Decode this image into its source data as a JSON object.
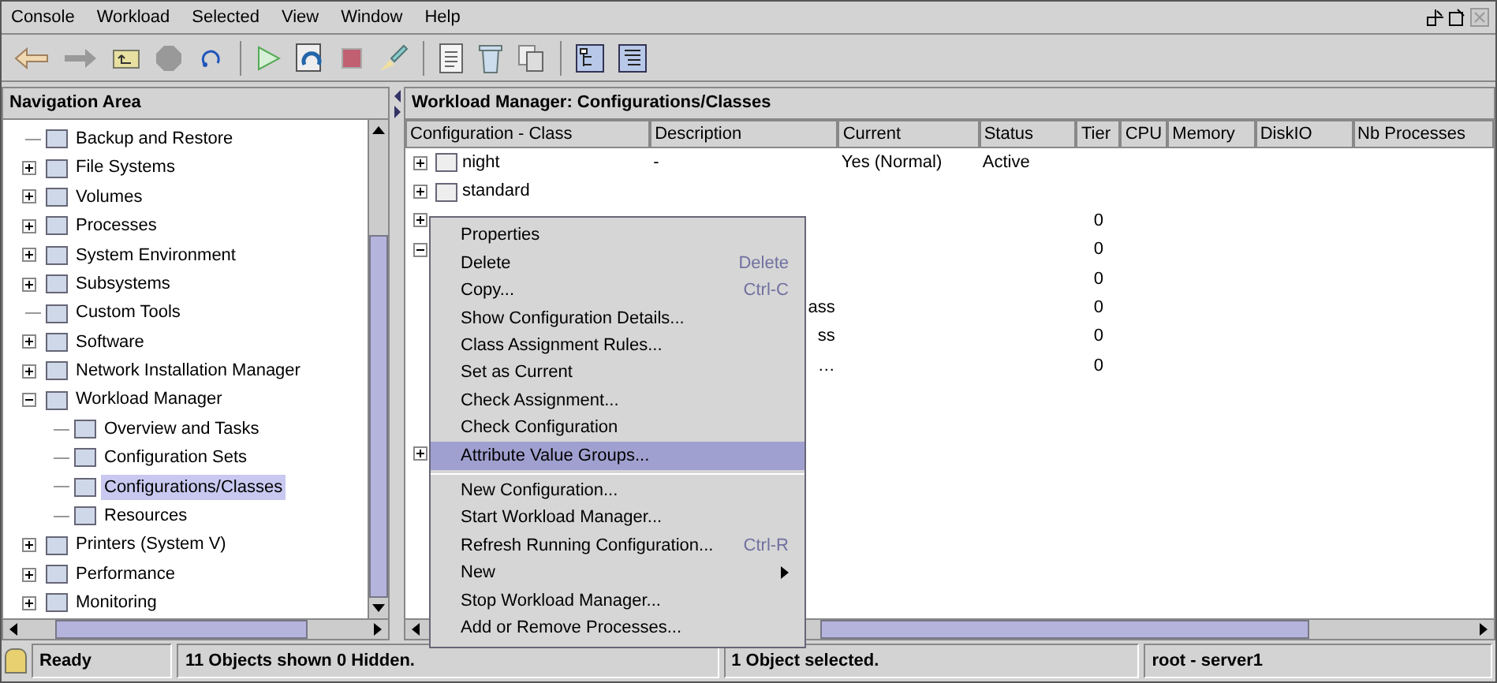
{
  "menu_bar": [
    "Console",
    "Workload",
    "Selected",
    "View",
    "Window",
    "Help"
  ],
  "navigation": {
    "title": "Navigation Area",
    "tree": [
      {
        "label": "Backup and Restore"
      },
      {
        "label": "File Systems",
        "expanded": false
      },
      {
        "label": "Volumes",
        "expanded": false
      },
      {
        "label": "Processes",
        "expanded": false
      },
      {
        "label": "System Environment",
        "expanded": false
      },
      {
        "label": "Subsystems",
        "expanded": false
      },
      {
        "label": "Custom Tools"
      },
      {
        "label": "Software",
        "expanded": false
      },
      {
        "label": "Network Installation Manager",
        "expanded": false
      },
      {
        "label": "Workload Manager",
        "expanded": true,
        "children": [
          {
            "label": "Overview and Tasks",
            "selected": false
          },
          {
            "label": "Configuration Sets",
            "selected": false
          },
          {
            "label": "Configurations/Classes",
            "selected": true
          },
          {
            "label": "Resources",
            "selected": false
          }
        ]
      },
      {
        "label": "Printers (System V)",
        "expanded": false
      },
      {
        "label": "Performance",
        "expanded": false
      },
      {
        "label": "Monitoring",
        "expanded": false
      }
    ]
  },
  "content": {
    "title": "Workload Manager: Configurations/Classes",
    "columns": [
      "Configuration - Class",
      "Description",
      "Current",
      "Status",
      "Tier",
      "CPU",
      "Memory",
      "DiskIO",
      "Nb Processes"
    ],
    "rows": [
      {
        "expanded": false,
        "cells": [
          "night",
          "-",
          "Yes (Normal)",
          "Active",
          "",
          "",
          "",
          "",
          ""
        ]
      },
      {
        "expanded": false,
        "cells": [
          "standard",
          "",
          "",
          "",
          "",
          "",
          "",
          "",
          ""
        ]
      },
      {
        "expanded": false,
        "cells": [
          "",
          "",
          "",
          "",
          "0",
          "",
          "",
          "",
          ""
        ]
      },
      {
        "expanded": true,
        "cells": [
          "",
          "",
          "",
          "",
          "0",
          "",
          "",
          "",
          ""
        ]
      },
      {
        "cells": [
          "",
          "",
          "",
          "",
          "0",
          "",
          "",
          "",
          ""
        ]
      },
      {
        "cells": [
          "",
          "ass",
          "",
          "",
          "0",
          "",
          "",
          "",
          ""
        ]
      },
      {
        "cells": [
          "",
          "ss",
          "",
          "",
          "0",
          "",
          "",
          "",
          ""
        ]
      },
      {
        "cells": [
          "",
          "…",
          "",
          "",
          "0",
          "",
          "",
          "",
          ""
        ]
      },
      {
        "cells": [
          "",
          "",
          "",
          "",
          "",
          "",
          "",
          "",
          ""
        ]
      },
      {
        "cells": [
          "",
          "",
          "",
          "",
          "",
          "",
          "",
          "",
          ""
        ]
      },
      {
        "expanded": false,
        "cells": [
          "",
          "",
          "",
          "",
          "",
          "",
          "",
          "",
          ""
        ]
      }
    ]
  },
  "context_menu": [
    {
      "kind": "item",
      "label": "Properties",
      "selected": false
    },
    {
      "kind": "item",
      "label": "Delete",
      "shortcut": "Delete",
      "selected": false
    },
    {
      "kind": "item",
      "label": "Copy...",
      "shortcut": "Ctrl-C",
      "selected": false
    },
    {
      "kind": "item",
      "label": "Show Configuration Details...",
      "selected": false
    },
    {
      "kind": "item",
      "label": "Class Assignment Rules...",
      "selected": false
    },
    {
      "kind": "item",
      "label": "Set as Current",
      "selected": false
    },
    {
      "kind": "item",
      "label": "Check Assignment...",
      "selected": false
    },
    {
      "kind": "item",
      "label": "Check Configuration",
      "selected": false
    },
    {
      "kind": "item",
      "label": "Attribute Value Groups...",
      "selected": true
    },
    {
      "kind": "separator"
    },
    {
      "kind": "item",
      "label": "New Configuration...",
      "selected": false
    },
    {
      "kind": "item",
      "label": "Start Workload Manager...",
      "selected": false
    },
    {
      "kind": "item",
      "label": "Refresh Running Configuration...",
      "shortcut": "Ctrl-R",
      "selected": false
    },
    {
      "kind": "item",
      "label": "New",
      "submenu": true,
      "selected": false
    },
    {
      "kind": "item",
      "label": "Stop Workload Manager...",
      "selected": false
    },
    {
      "kind": "item",
      "label": "Add or Remove Processes...",
      "selected": false
    }
  ],
  "status_bar": [
    "Ready",
    "11 Objects shown 0 Hidden.",
    "1 Object selected.",
    "root - server1"
  ]
}
